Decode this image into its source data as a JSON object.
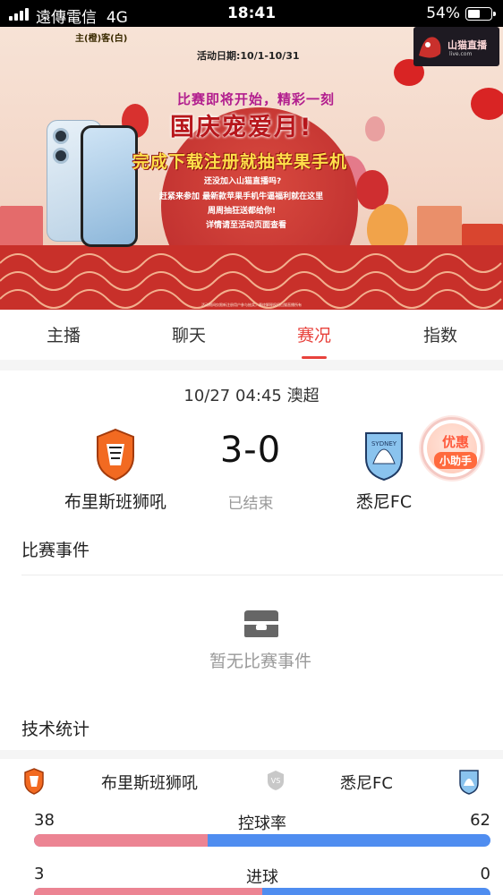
{
  "status_bar": {
    "carrier": "遠傳電信",
    "network": "4G",
    "time": "18:41",
    "battery": "54%",
    "battery_level": 0.54
  },
  "banner": {
    "home_away_note": "主(橙)客(白)",
    "date": "活动日期:10/1-10/31",
    "logo_text": "山猫直播",
    "logo_sub": "live.com",
    "subtitle": "比赛即将开始，精彩一刻",
    "headline": "国庆宠爱月!",
    "slogan": "完成下载注册就抽苹果手机",
    "lines": [
      "还没加入山猫直播吗?",
      "赶紧来参加  最新款苹果手机牛逼福利就在这里",
      "周周抽狂送都给你!",
      "详情请至活动页面查看"
    ],
    "caption": "活动期间仅限新注册用户参与抽奖，最终解释权归山猫直播所有"
  },
  "tabs": [
    {
      "label": "主播",
      "active": false
    },
    {
      "label": "聊天",
      "active": false
    },
    {
      "label": "赛况",
      "active": true
    },
    {
      "label": "指数",
      "active": false
    }
  ],
  "match": {
    "datetime_league": "10/27 04:45 澳超",
    "home_team": "布里斯班狮吼",
    "away_team": "悉尼FC",
    "score": "3-0",
    "status": "已结束",
    "helper_line1": "优惠",
    "helper_line2": "小助手"
  },
  "events": {
    "title": "比赛事件",
    "empty_text": "暂无比赛事件"
  },
  "stats": {
    "title": "技术统计",
    "home_team": "布里斯班狮吼",
    "away_team": "悉尼FC",
    "rows": [
      {
        "label": "控球率",
        "home": "38",
        "away": "62",
        "home_share": 0.38
      },
      {
        "label": "进球",
        "home": "3",
        "away": "0",
        "home_share": 0.5
      }
    ]
  },
  "colors": {
    "accent": "#e8423c",
    "home_bar": "#ec8493",
    "away_bar": "#4f8df0"
  },
  "icons": {
    "home_logo": "brisbane-roar-crest-icon",
    "away_logo": "sydney-fc-crest-icon",
    "empty": "inbox-tray-icon",
    "vs": "vs-badge-icon"
  }
}
